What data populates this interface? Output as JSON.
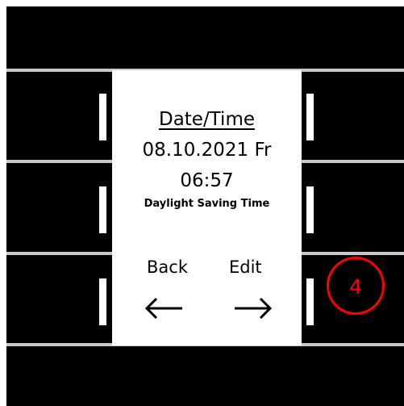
{
  "display": {
    "title": "Date/Time",
    "date": "08.10.2021 Fr",
    "time": "06:57",
    "dst_label": "Daylight Saving Time",
    "back_label": "Back",
    "edit_label": "Edit"
  },
  "annotation": {
    "badge_number": "4",
    "badge_color": "#ff0000"
  },
  "icons": {
    "back": "arrow-left-icon",
    "edit": "arrow-right-icon"
  },
  "colors": {
    "frame": "#000000",
    "divider": "#c8c8c8",
    "screen": "#ffffff"
  }
}
